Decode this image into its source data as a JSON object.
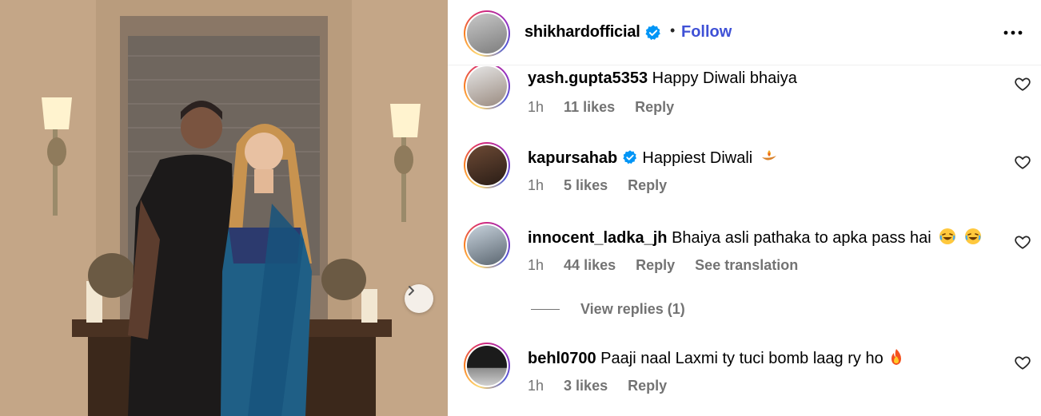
{
  "header": {
    "username": "shikhardofficial",
    "separator": "•",
    "follow_label": "Follow"
  },
  "comments": [
    {
      "username": "yash.gupta5353",
      "text": "Happy Diwali bhaiya",
      "time": "1h",
      "likes": "11 likes",
      "reply_label": "Reply"
    },
    {
      "username": "kapursahab",
      "text": "Happiest Diwali",
      "time": "1h",
      "likes": "5 likes",
      "reply_label": "Reply"
    },
    {
      "username": "innocent_ladka_jh",
      "text": "Bhaiya asli pathaka to apka pass hai",
      "time": "1h",
      "likes": "44 likes",
      "reply_label": "Reply",
      "translate_label": "See translation"
    },
    {
      "username": "behl0700",
      "text": "Paaji naal Laxmi ty tuci bomb laag ry ho",
      "time": "1h",
      "likes": "3 likes",
      "reply_label": "Reply"
    }
  ],
  "view_replies_label": "View replies (1)",
  "icons": {
    "verified": "verified-badge-icon",
    "more": "more-options-icon",
    "like": "heart-icon",
    "next": "chevron-right-icon"
  },
  "colors": {
    "follow": "#3f51d6",
    "verified": "#0095f6",
    "secondary_text": "#737373"
  }
}
